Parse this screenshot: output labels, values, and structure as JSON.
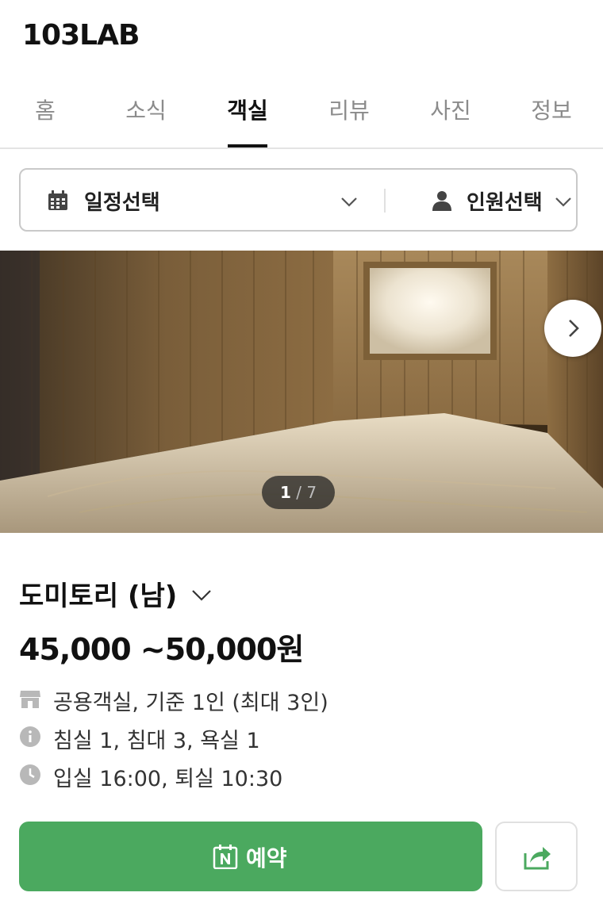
{
  "brand": "103LAB",
  "tabs": [
    {
      "label": "홈",
      "active": false
    },
    {
      "label": "소식",
      "active": false
    },
    {
      "label": "객실",
      "active": true
    },
    {
      "label": "리뷰",
      "active": false
    },
    {
      "label": "사진",
      "active": false
    },
    {
      "label": "정보",
      "active": false
    }
  ],
  "filter": {
    "date_label": "일정선택",
    "date_icon": "calendar-icon",
    "people_label": "인원선택",
    "people_icon": "person-icon"
  },
  "gallery": {
    "current": "1",
    "separator": "/",
    "total": "7",
    "next_icon": "chevron-right-icon"
  },
  "room": {
    "name": "도미토리 (남)",
    "price": "45,000 ~50,000원",
    "details": [
      {
        "icon": "store-icon",
        "text": "공용객실, 기준 1인 (최대 3인)"
      },
      {
        "icon": "info-icon",
        "text": "침실 1, 침대 3, 욕실 1"
      },
      {
        "icon": "clock-icon",
        "text": "입실 16:00, 퇴실 10:30"
      }
    ]
  },
  "actions": {
    "reserve_label": "예약",
    "reserve_icon": "naver-calendar-icon",
    "share_icon": "share-icon"
  },
  "colors": {
    "accent_green": "#4ba95f",
    "icon_gray": "#b8b8b8",
    "tab_inactive": "#8b8b8b"
  }
}
